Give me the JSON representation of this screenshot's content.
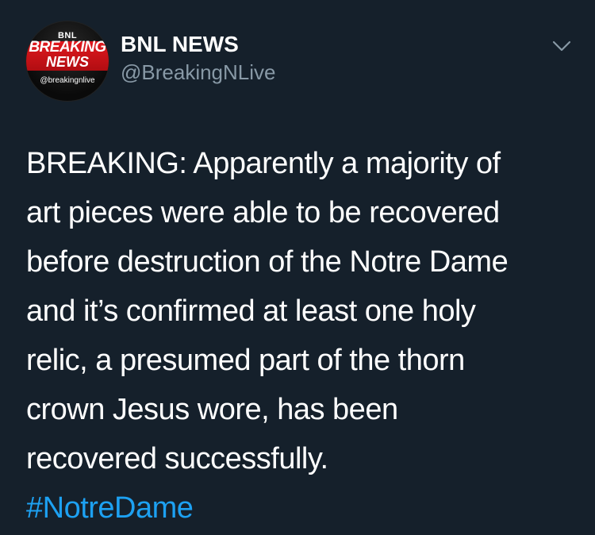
{
  "avatar": {
    "top_text": "BNL",
    "line1": "BREAKING",
    "line2": "NEWS",
    "handle_text": "@breakingnlive"
  },
  "author": {
    "display_name": "BNL NEWS",
    "handle": "@BreakingNLive"
  },
  "tweet": {
    "lines": [
      "BREAKING: Apparently a majority of",
      "art pieces were able to be recovered",
      "before destruction of the Notre Dame",
      "and it’s confirmed at least one holy",
      "relic, a presumed part of the thorn",
      "crown Jesus wore, has been",
      "recovered successfully."
    ],
    "hashtag": "#NotreDame"
  },
  "icons": {
    "menu": "chevron-down-icon"
  },
  "colors": {
    "background": "#15202b",
    "text": "#ffffff",
    "secondary_text": "#8899a6",
    "link": "#1da1f2",
    "avatar_red": "#e0191e"
  }
}
